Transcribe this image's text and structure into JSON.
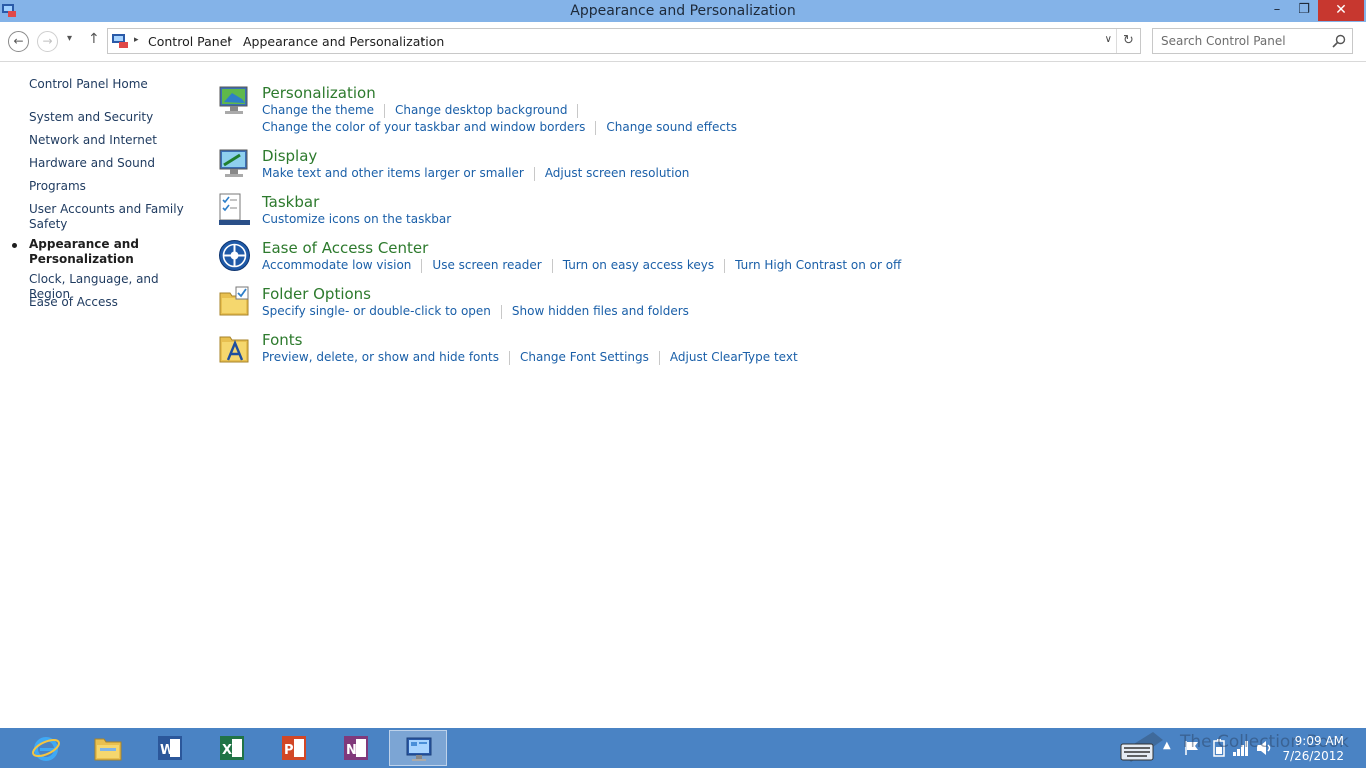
{
  "window": {
    "title": "Appearance and Personalization"
  },
  "window_controls": {
    "minimize": "–",
    "maximize": "❐",
    "close": "✕"
  },
  "nav": {
    "back_glyph": "←",
    "forward_glyph": "→",
    "recent_glyph": "▾",
    "up_glyph": "↑",
    "breadcrumbs": [
      "Control Panel",
      "Appearance and Personalization"
    ],
    "crumb_sep": "▸",
    "dropdown_glyph": "∨",
    "refresh_glyph": "↻",
    "search_placeholder": "Search Control Panel"
  },
  "sidebar": {
    "home": "Control Panel Home",
    "items": [
      {
        "label": "System and Security",
        "current": false
      },
      {
        "label": "Network and Internet",
        "current": false
      },
      {
        "label": "Hardware and Sound",
        "current": false
      },
      {
        "label": "Programs",
        "current": false
      },
      {
        "label": "User Accounts and Family Safety",
        "current": false
      },
      {
        "label": "Appearance and Personalization",
        "current": true
      },
      {
        "label": "Clock, Language, and Region",
        "current": false
      },
      {
        "label": "Ease of Access",
        "current": false
      }
    ]
  },
  "categories": [
    {
      "title": "Personalization",
      "icon": "personalization-icon",
      "links": [
        [
          "Change the theme",
          "Change desktop background"
        ],
        [
          "Change the color of your taskbar and window borders",
          "Change sound effects"
        ]
      ]
    },
    {
      "title": "Display",
      "icon": "display-icon",
      "links": [
        [
          "Make text and other items larger or smaller",
          "Adjust screen resolution"
        ]
      ]
    },
    {
      "title": "Taskbar",
      "icon": "taskbar-icon",
      "links": [
        [
          "Customize icons on the taskbar"
        ]
      ]
    },
    {
      "title": "Ease of Access Center",
      "icon": "ease-of-access-icon",
      "links": [
        [
          "Accommodate low vision",
          "Use screen reader",
          "Turn on easy access keys",
          "Turn High Contrast on or off"
        ]
      ]
    },
    {
      "title": "Folder Options",
      "icon": "folder-options-icon",
      "links": [
        [
          "Specify single- or double-click to open",
          "Show hidden files and folders"
        ]
      ]
    },
    {
      "title": "Fonts",
      "icon": "fonts-icon",
      "links": [
        [
          "Preview, delete, or show and hide fonts",
          "Change Font Settings",
          "Adjust ClearType text"
        ]
      ]
    }
  ],
  "taskbar": {
    "apps": [
      "internet-explorer-icon",
      "file-explorer-icon",
      "word-icon",
      "excel-icon",
      "powerpoint-icon",
      "onenote-icon",
      "control-panel-icon"
    ],
    "active_app": "control-panel-icon",
    "clock_time": "9:09 AM",
    "clock_date": "7/26/2012",
    "watermark": "The Collection Book"
  },
  "colors": {
    "titlebar": "#84b3e8",
    "taskbar": "#4a83c4",
    "link": "#1a5fa8",
    "category_title": "#2d7a2d",
    "close_button": "#c7372f"
  }
}
